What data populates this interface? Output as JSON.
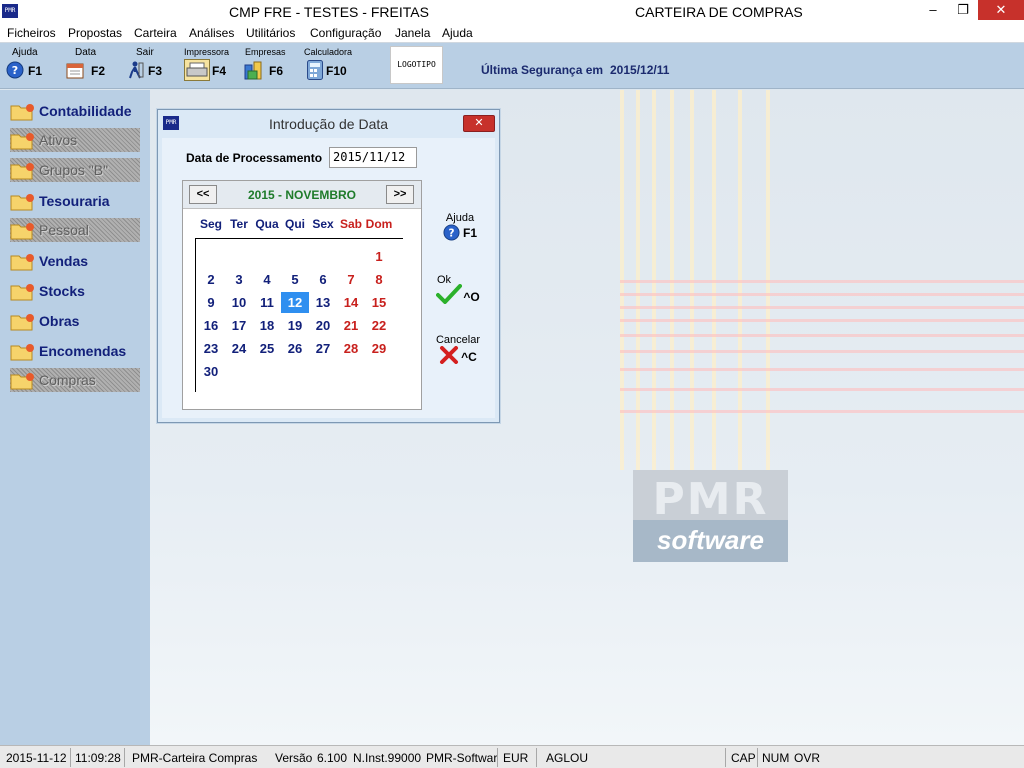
{
  "window": {
    "app_icon_text": "PMR",
    "title": "CMP FRE - TESTES - FREITAS",
    "module_title": "CARTEIRA DE COMPRAS",
    "controls": {
      "minimize": "–",
      "restore": "❐",
      "close": "✕"
    }
  },
  "menu": [
    "Ficheiros",
    "Propostas",
    "Carteira",
    "Análises",
    "Utilitários",
    "Configuração",
    "Janela",
    "Ajuda"
  ],
  "toolbar": {
    "buttons": [
      {
        "label": "Ajuda",
        "key": "F1",
        "icon": "help-icon"
      },
      {
        "label": "Data",
        "key": "F2",
        "icon": "calendar-icon"
      },
      {
        "label": "Sair",
        "key": "F3",
        "icon": "exit-icon"
      },
      {
        "label": "Impressora",
        "key": "F4",
        "icon": "printer-icon"
      },
      {
        "label": "Empresas",
        "key": "F6",
        "icon": "companies-icon"
      },
      {
        "label": "Calculadora",
        "key": "F10",
        "icon": "calculator-icon"
      }
    ],
    "logo_text": "LOGOTIPO",
    "backup_label": "Última Segurança em",
    "backup_date": "2015/12/11"
  },
  "sidebar": [
    {
      "label": "Contabilidade",
      "enabled": true
    },
    {
      "label": "Ativos",
      "enabled": false
    },
    {
      "label": "Grupos \"B\"",
      "enabled": false
    },
    {
      "label": "Tesouraria",
      "enabled": true
    },
    {
      "label": "Pessoal",
      "enabled": false
    },
    {
      "label": "Vendas",
      "enabled": true
    },
    {
      "label": "Stocks",
      "enabled": true
    },
    {
      "label": "Obras",
      "enabled": true
    },
    {
      "label": "Encomendas",
      "enabled": true
    },
    {
      "label": "Compras",
      "enabled": false
    }
  ],
  "background_logo": {
    "brand": "PMR",
    "tagline": "software"
  },
  "dialog": {
    "title": "Introdução de Data",
    "close_label": "✕",
    "date_label": "Data de Processamento",
    "date_value": "2015/11/12",
    "calendar": {
      "prev": "<<",
      "next": ">>",
      "month_title": "2015 - NOVEMBRO",
      "weekdays": [
        "Seg",
        "Ter",
        "Qua",
        "Qui",
        "Sex",
        "Sab",
        "Dom"
      ],
      "weeks": [
        [
          "",
          "",
          "",
          "",
          "",
          "",
          "1"
        ],
        [
          "2",
          "3",
          "4",
          "5",
          "6",
          "7",
          "8"
        ],
        [
          "9",
          "10",
          "11",
          "12",
          "13",
          "14",
          "15"
        ],
        [
          "16",
          "17",
          "18",
          "19",
          "20",
          "21",
          "22"
        ],
        [
          "23",
          "24",
          "25",
          "26",
          "27",
          "28",
          "29"
        ],
        [
          "30",
          "",
          "",
          "",
          "",
          "",
          ""
        ]
      ],
      "selected_day": "12"
    },
    "help_button": {
      "label": "Ajuda",
      "key": "F1"
    },
    "ok_button": {
      "label": "Ok",
      "key": "^O"
    },
    "cancel_button": {
      "label": "Cancelar",
      "key": "^C"
    }
  },
  "status_bar": {
    "date": "2015-11-12",
    "time": "11:09:28",
    "app": "PMR-Carteira Compras",
    "version_label": "Versão",
    "version": "6.100",
    "install": "N.Inst.99000",
    "vendor": "PMR-Softwar",
    "currency": "EUR",
    "user": "AGLOU",
    "caps": "CAP",
    "num": "NUM",
    "ovr": "OVR"
  },
  "colors": {
    "accent_navy": "#12207a",
    "weekend_red": "#c8201d",
    "month_green": "#1e7b2a",
    "selected_day": "#2f8ff0",
    "close_red": "#c7312b"
  }
}
